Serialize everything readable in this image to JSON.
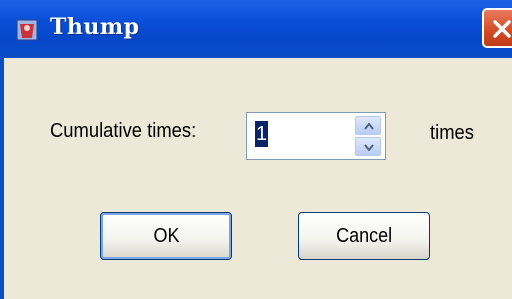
{
  "window": {
    "title": "Thump",
    "close_icon": "close-icon",
    "app_icon": "app-icon"
  },
  "form": {
    "label": "Cumulative times:",
    "value": "1",
    "unit": "times",
    "spin_up_icon": "arrow-up-icon",
    "spin_down_icon": "arrow-down-icon"
  },
  "buttons": {
    "ok": "OK",
    "cancel": "Cancel"
  },
  "colors": {
    "titlebar": "#0a4fd8",
    "close": "#d24a26",
    "dialog_bg": "#ece9d8"
  }
}
